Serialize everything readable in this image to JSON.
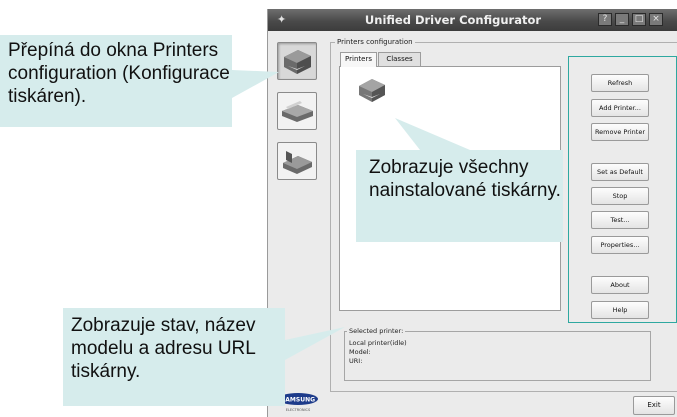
{
  "window": {
    "title": "Unified Driver Configurator",
    "controls": [
      "?",
      "_",
      "□",
      "×"
    ],
    "group_label": "Printers configuration",
    "tabs": [
      {
        "label": "Printers",
        "active": true
      },
      {
        "label": "Classes",
        "active": false
      }
    ],
    "buttons": [
      {
        "label": "Refresh"
      },
      {
        "label": "Add Printer..."
      },
      {
        "label": "Remove Printer"
      },
      {
        "label": "Set as Default"
      },
      {
        "label": "Stop"
      },
      {
        "label": "Test..."
      },
      {
        "label": "Properties..."
      },
      {
        "label": "About"
      },
      {
        "label": "Help"
      }
    ],
    "selected_printer": {
      "title": "Selected printer:",
      "status_line": "Local printer(idle)",
      "model_label": "Model:",
      "uri_label": "URI:"
    },
    "logo_text": "SAMSUNG",
    "logo_subtext": "ELECTRONICS",
    "exit_label": "Exit"
  },
  "callouts": {
    "printers_config": "Přepíná do okna Printers configuration (Konfigurace tiskáren).",
    "installed_printers": "Zobrazuje všechny nainstalované tiskárny.",
    "printer_status": "Zobrazuje stav, název modelu a adresu URL tiskárny."
  },
  "colors": {
    "callout_bg": "#d6ecec",
    "highlight": "#2ea8a0",
    "titlebar": "#4a4a4a"
  }
}
